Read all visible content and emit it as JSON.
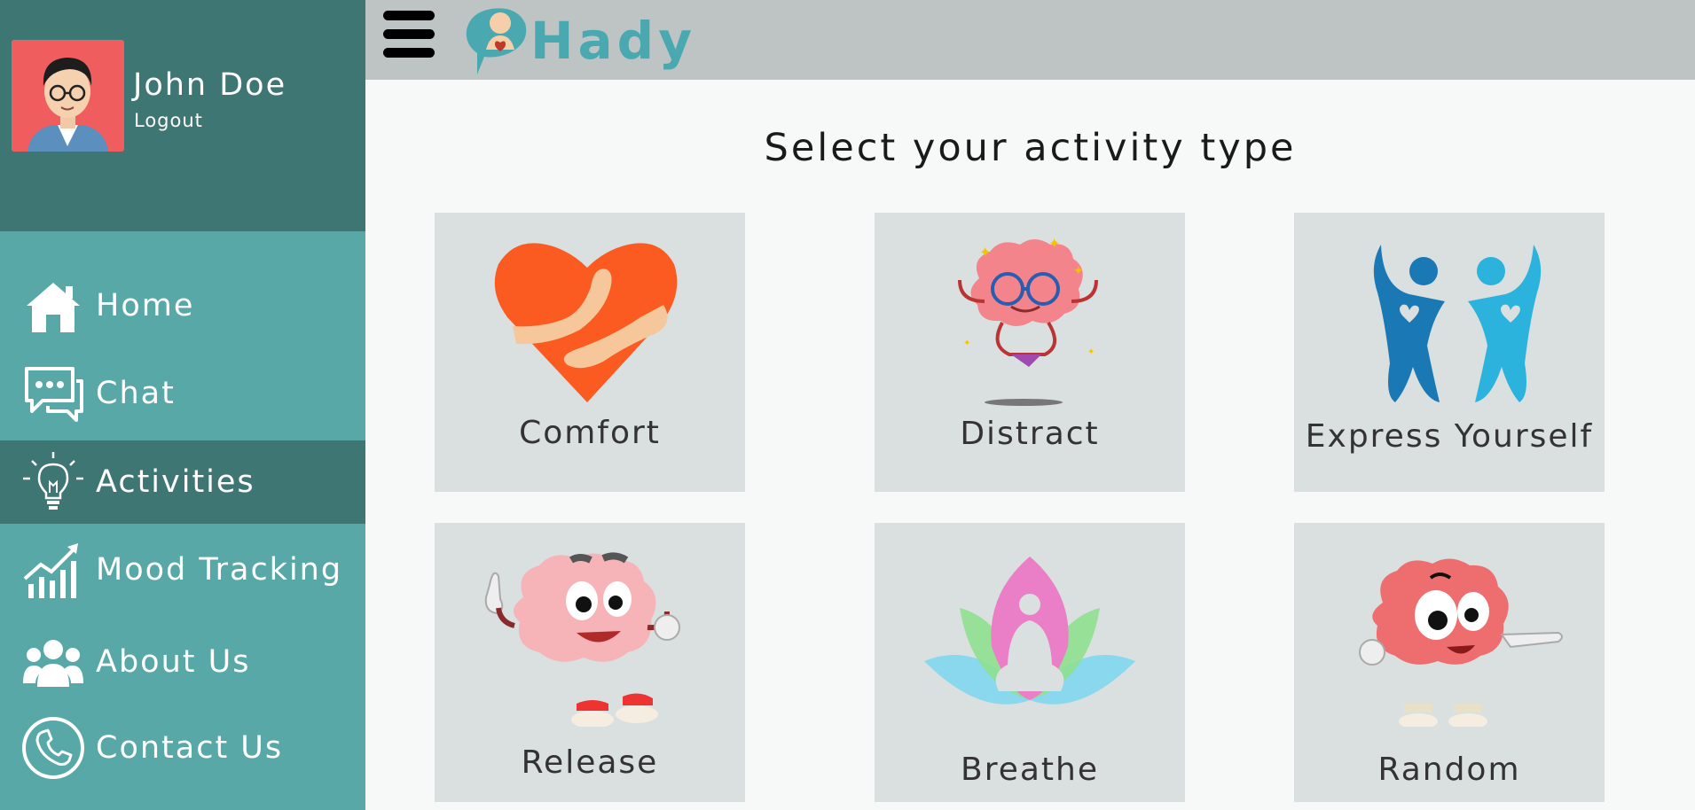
{
  "user": {
    "name": "John Doe",
    "logout_label": "Logout"
  },
  "nav": {
    "items": [
      {
        "label": "Home",
        "icon": "home-icon"
      },
      {
        "label": "Chat",
        "icon": "chat-icon"
      },
      {
        "label": "Activities",
        "icon": "lightbulb-icon",
        "active": true
      },
      {
        "label": "Mood Tracking",
        "icon": "chart-icon"
      },
      {
        "label": "About Us",
        "icon": "group-icon"
      },
      {
        "label": "Contact Us",
        "icon": "phone-icon"
      }
    ]
  },
  "header": {
    "logo_text": "Hady"
  },
  "main": {
    "title": "Select your activity type",
    "cards": [
      {
        "label": "Comfort",
        "icon": "heart-hug-icon"
      },
      {
        "label": "Distract",
        "icon": "meditating-brain-icon"
      },
      {
        "label": "Express Yourself",
        "icon": "dancing-people-icon"
      },
      {
        "label": "Release",
        "icon": "happy-brain-icon"
      },
      {
        "label": "Breathe",
        "icon": "lotus-meditation-icon"
      },
      {
        "label": "Random",
        "icon": "pointing-brain-icon"
      }
    ]
  },
  "colors": {
    "sidebar": "#58a8a8",
    "sidebar_dark": "#3e7674",
    "header": "#bec4c4",
    "card": "#dadfe0",
    "logo": "#4aa9b0"
  }
}
